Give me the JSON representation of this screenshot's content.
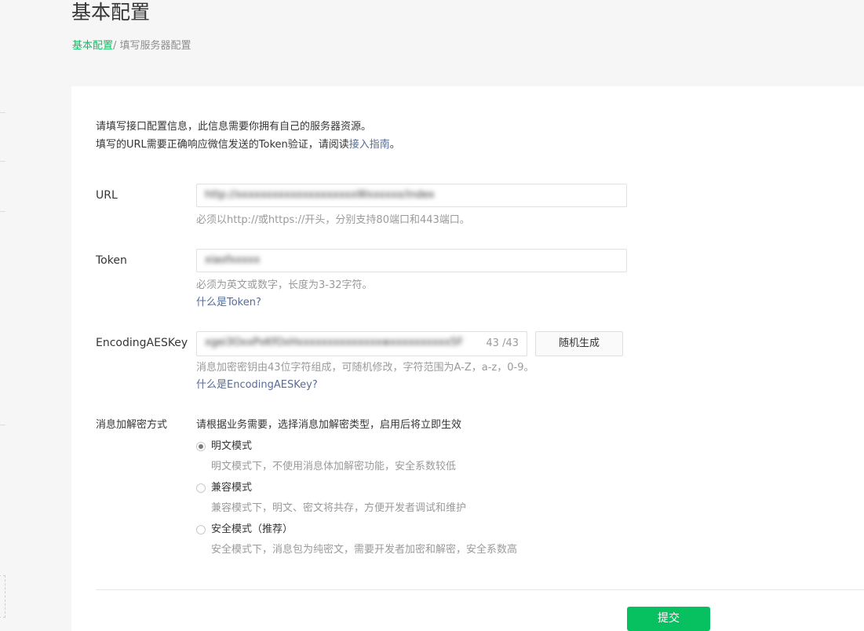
{
  "header": {
    "title": "基本配置",
    "breadcrumb": {
      "link": "基本配置",
      "separator": "/ ",
      "current": "填写服务器配置"
    }
  },
  "intro": {
    "line1": "请填写接口配置信息，此信息需要你拥有自己的服务器资源。",
    "line2_prefix": "填写的URL需要正确响应微信发送的Token验证，请阅读",
    "line2_link": "接入指南",
    "line2_suffix": "。"
  },
  "form": {
    "url": {
      "label": "URL",
      "value": "http://xxxxxxxxxxxxxxxxxxxxWxxxxxx/index",
      "tip": "必须以http://或https://开头，分别支持80端口和443端口。"
    },
    "token": {
      "label": "Token",
      "value": "xiaofxxxxx",
      "tip": "必须为英文或数字，长度为3-32字符。",
      "help": "什么是Token?"
    },
    "aeskey": {
      "label": "EncodingAESKey",
      "value": "xgei3OxxPxKfOxHxxxxxxxxxxxxxxwxxxxxxxxxx5Fk",
      "count": "43 /43",
      "random_button": "随机生成",
      "tip": "消息加密密钥由43位字符组成，可随机修改，字符范围为A-Z，a-z，0-9。",
      "help": "什么是EncodingAESKey?"
    },
    "encryption": {
      "label": "消息加解密方式",
      "description": "请根据业务需要，选择消息加解密类型，启用后将立即生效",
      "options": [
        {
          "label": "明文模式",
          "desc": "明文模式下，不使用消息体加解密功能，安全系数较低",
          "checked": true
        },
        {
          "label": "兼容模式",
          "desc": "兼容模式下，明文、密文将共存，方便开发者调试和维护",
          "checked": false
        },
        {
          "label": "安全模式（推荐）",
          "desc": "安全模式下，消息包为纯密文，需要开发者加密和解密，安全系数高",
          "checked": false
        }
      ]
    },
    "submit": "提交"
  },
  "colors": {
    "accent": "#07c160",
    "link": "#576b95",
    "muted": "#9a9a9a"
  }
}
